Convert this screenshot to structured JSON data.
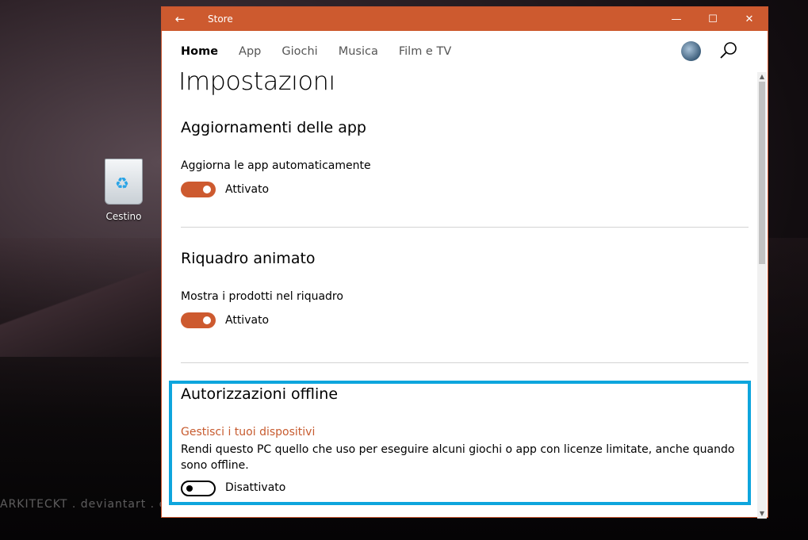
{
  "desktop": {
    "recycle_bin_label": "Cestino",
    "watermark": "ARKITECKT . deviantart . com"
  },
  "window": {
    "title": "Store",
    "accent_color": "#cd5a2f"
  },
  "nav": {
    "items": [
      "Home",
      "App",
      "Giochi",
      "Musica",
      "Film e TV"
    ],
    "active": "Home"
  },
  "page": {
    "title": "Impostazioni"
  },
  "sections": {
    "updates": {
      "title": "Aggiornamenti delle app",
      "setting_label": "Aggiorna le app automaticamente",
      "toggle_state": "Attivato"
    },
    "live_tile": {
      "title": "Riquadro animato",
      "setting_label": "Mostra i prodotti nel riquadro",
      "toggle_state": "Attivato"
    },
    "offline": {
      "title": "Autorizzazioni offline",
      "link": "Gestisci i tuoi dispositivi",
      "description": "Rendi questo PC quello che uso per eseguire alcuni giochi o app con licenze limitate, anche quando sono offline.",
      "toggle_state": "Disattivato"
    }
  },
  "highlight_color": "#0ea5dd"
}
